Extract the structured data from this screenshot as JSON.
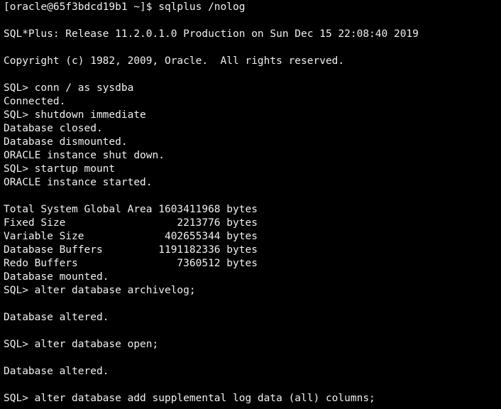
{
  "terminal": {
    "lines": [
      "[oracle@65f3bdcd19b1 ~]$ sqlplus /nolog",
      "",
      "SQL*Plus: Release 11.2.0.1.0 Production on Sun Dec 15 22:08:40 2019",
      "",
      "Copyright (c) 1982, 2009, Oracle.  All rights reserved.",
      "",
      "SQL> conn / as sysdba",
      "Connected.",
      "SQL> shutdown immediate",
      "Database closed.",
      "Database dismounted.",
      "ORACLE instance shut down.",
      "SQL> startup mount",
      "ORACLE instance started.",
      "",
      "Total System Global Area 1603411968 bytes",
      "Fixed Size                  2213776 bytes",
      "Variable Size             402655344 bytes",
      "Database Buffers         1191182336 bytes",
      "Redo Buffers                7360512 bytes",
      "Database mounted.",
      "SQL> alter database archivelog;",
      "",
      "Database altered.",
      "",
      "SQL> alter database open;",
      "",
      "Database altered.",
      "",
      "SQL> alter database add supplemental log data (all) columns;"
    ]
  },
  "colors": {
    "background": "#000000",
    "foreground": "#f0f0f0"
  }
}
